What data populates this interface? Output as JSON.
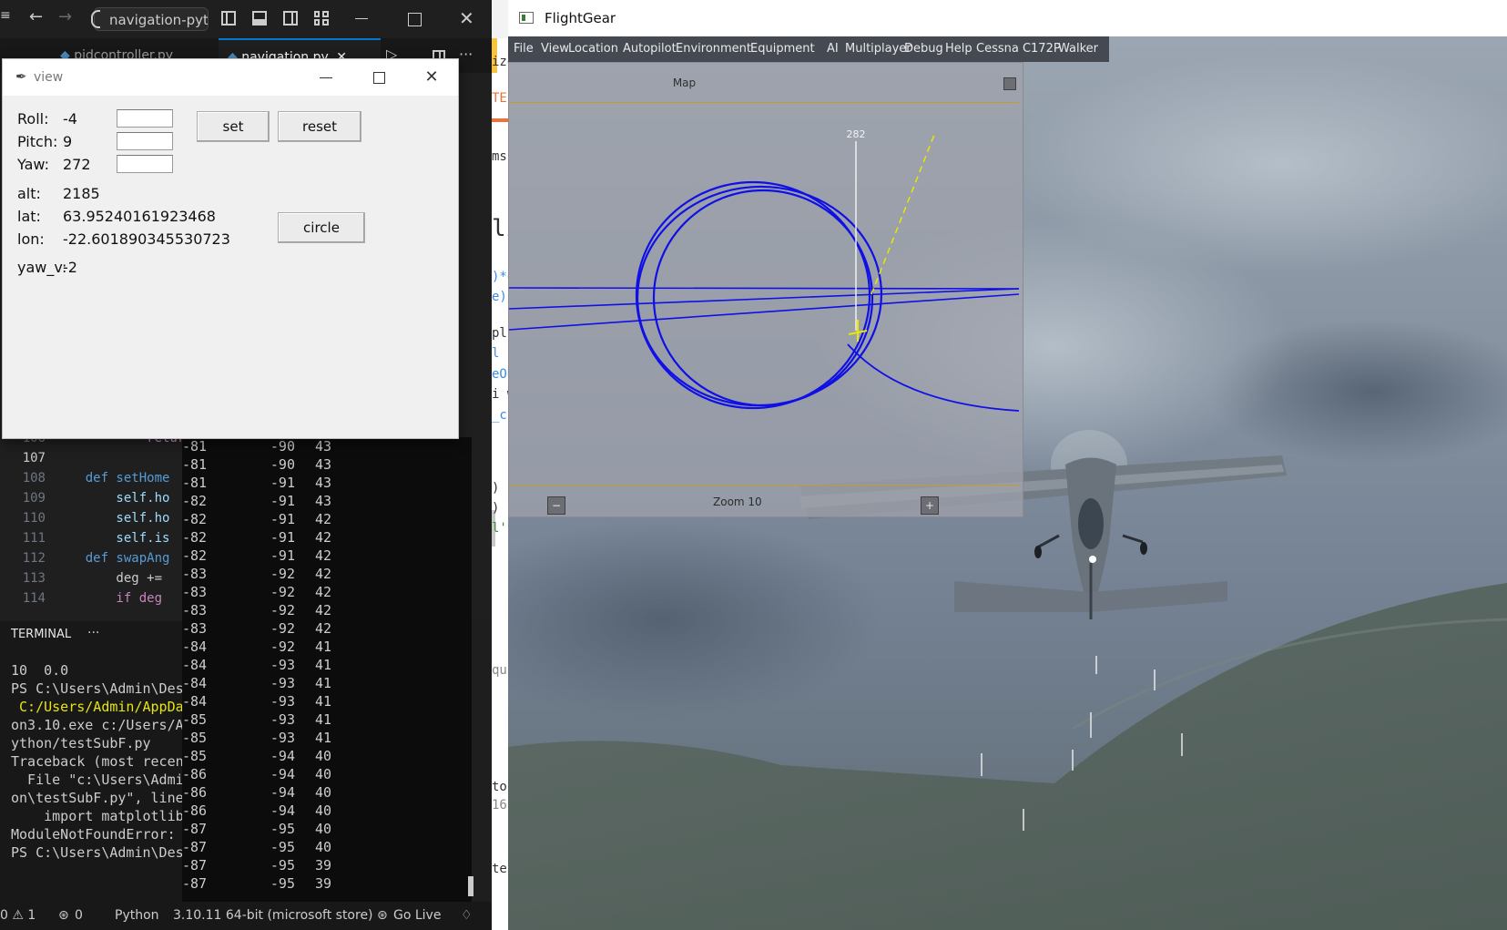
{
  "vscode": {
    "search_text": "navigation-pytho",
    "tabs": [
      "pidcontroller.py",
      "navigation.py"
    ],
    "code": [
      {
        "n": "106",
        "text": "            return"
      },
      {
        "n": "107",
        "text": ""
      },
      {
        "n": "108",
        "text": "    def setHome"
      },
      {
        "n": "109",
        "text": "        self.ho"
      },
      {
        "n": "110",
        "text": "        self.ho"
      },
      {
        "n": "111",
        "text": "        self.is"
      },
      {
        "n": "112",
        "text": "    def swapAng"
      },
      {
        "n": "113",
        "text": "        deg +="
      },
      {
        "n": "114",
        "text": "        if deg"
      }
    ],
    "terminal_tab": "TERMINAL",
    "terminal_more": "···",
    "terminal_lines": [
      {
        "t": "10  0.0",
        "y": false
      },
      {
        "t": "PS C:\\Users\\Admin\\Des",
        "y": false
      },
      {
        "t": " C:/Users/Admin/AppDa",
        "y": true
      },
      {
        "t": "on3.10.exe c:/Users/A",
        "y": false
      },
      {
        "t": "ython/testSubF.py",
        "y": false
      },
      {
        "t": "Traceback (most recen",
        "y": false
      },
      {
        "t": "  File \"c:\\Users\\Admi",
        "y": false
      },
      {
        "t": "on\\testSubF.py\", line",
        "y": false
      },
      {
        "t": "    import matplotlib",
        "y": false
      },
      {
        "t": "ModuleNotFoundError:",
        "y": false
      },
      {
        "t": "PS C:\\Users\\Admin\\Des",
        "y": false
      }
    ],
    "output_rows": [
      [
        "-81",
        "-90",
        "43"
      ],
      [
        "-81",
        "-90",
        "43"
      ],
      [
        "-81",
        "-91",
        "43"
      ],
      [
        "-82",
        "-91",
        "43"
      ],
      [
        "-82",
        "-91",
        "42"
      ],
      [
        "-82",
        "-91",
        "42"
      ],
      [
        "-82",
        "-91",
        "42"
      ],
      [
        "-83",
        "-92",
        "42"
      ],
      [
        "-83",
        "-92",
        "42"
      ],
      [
        "-83",
        "-92",
        "42"
      ],
      [
        "-83",
        "-92",
        "42"
      ],
      [
        "-84",
        "-92",
        "41"
      ],
      [
        "-84",
        "-93",
        "41"
      ],
      [
        "-84",
        "-93",
        "41"
      ],
      [
        "-84",
        "-93",
        "41"
      ],
      [
        "-85",
        "-93",
        "41"
      ],
      [
        "-85",
        "-93",
        "41"
      ],
      [
        "-85",
        "-94",
        "40"
      ],
      [
        "-86",
        "-94",
        "40"
      ],
      [
        "-86",
        "-94",
        "40"
      ],
      [
        "-86",
        "-94",
        "40"
      ],
      [
        "-87",
        "-95",
        "40"
      ],
      [
        "-87",
        "-95",
        "40"
      ],
      [
        "-87",
        "-95",
        "39"
      ],
      [
        "-87",
        "-95",
        "39"
      ]
    ],
    "status": {
      "problems": "0 ⚠ 1",
      "ports": "0",
      "language": "Python",
      "interpreter": "3.10.11 64-bit (microsoft store)",
      "golive": "Go Live"
    }
  },
  "mid_window": {
    "fragments": [
      "ize",
      "TEF",
      "ms",
      "li",
      ")*ear",
      "e)*ea",
      "pl",
      "l",
      "eOU",
      "i wi",
      "_c",
      ")",
      ")",
      "l'",
      "to",
      "16:",
      "qu",
      "te"
    ]
  },
  "view_window": {
    "title": "view",
    "roll_label": "Roll:",
    "roll": "-4",
    "pitch_label": "Pitch:",
    "pitch": "9",
    "yaw_label": "Yaw:",
    "yaw": "272",
    "alt_label": "alt:",
    "alt": "2185",
    "lat_label": "lat:",
    "lat": "63.95240161923468",
    "lon_label": "lon:",
    "lon": "-22.601890345530723",
    "yaw_v_label": "yaw_v:",
    "yaw_v": "-2",
    "set_button": "set",
    "reset_button": "reset",
    "circle_button": "circle"
  },
  "flightgear": {
    "title": "FlightGear",
    "menu": [
      "File",
      "View",
      "Location",
      "Autopilot",
      "Environment",
      "Equipment",
      "AI",
      "Multiplayer",
      "Debug",
      "Help",
      "Cessna C172P",
      "Walker"
    ],
    "map_title": "Map",
    "heading_label": "282",
    "zoom_label": "Zoom 10",
    "zoom_out": "−",
    "zoom_in": "+"
  }
}
